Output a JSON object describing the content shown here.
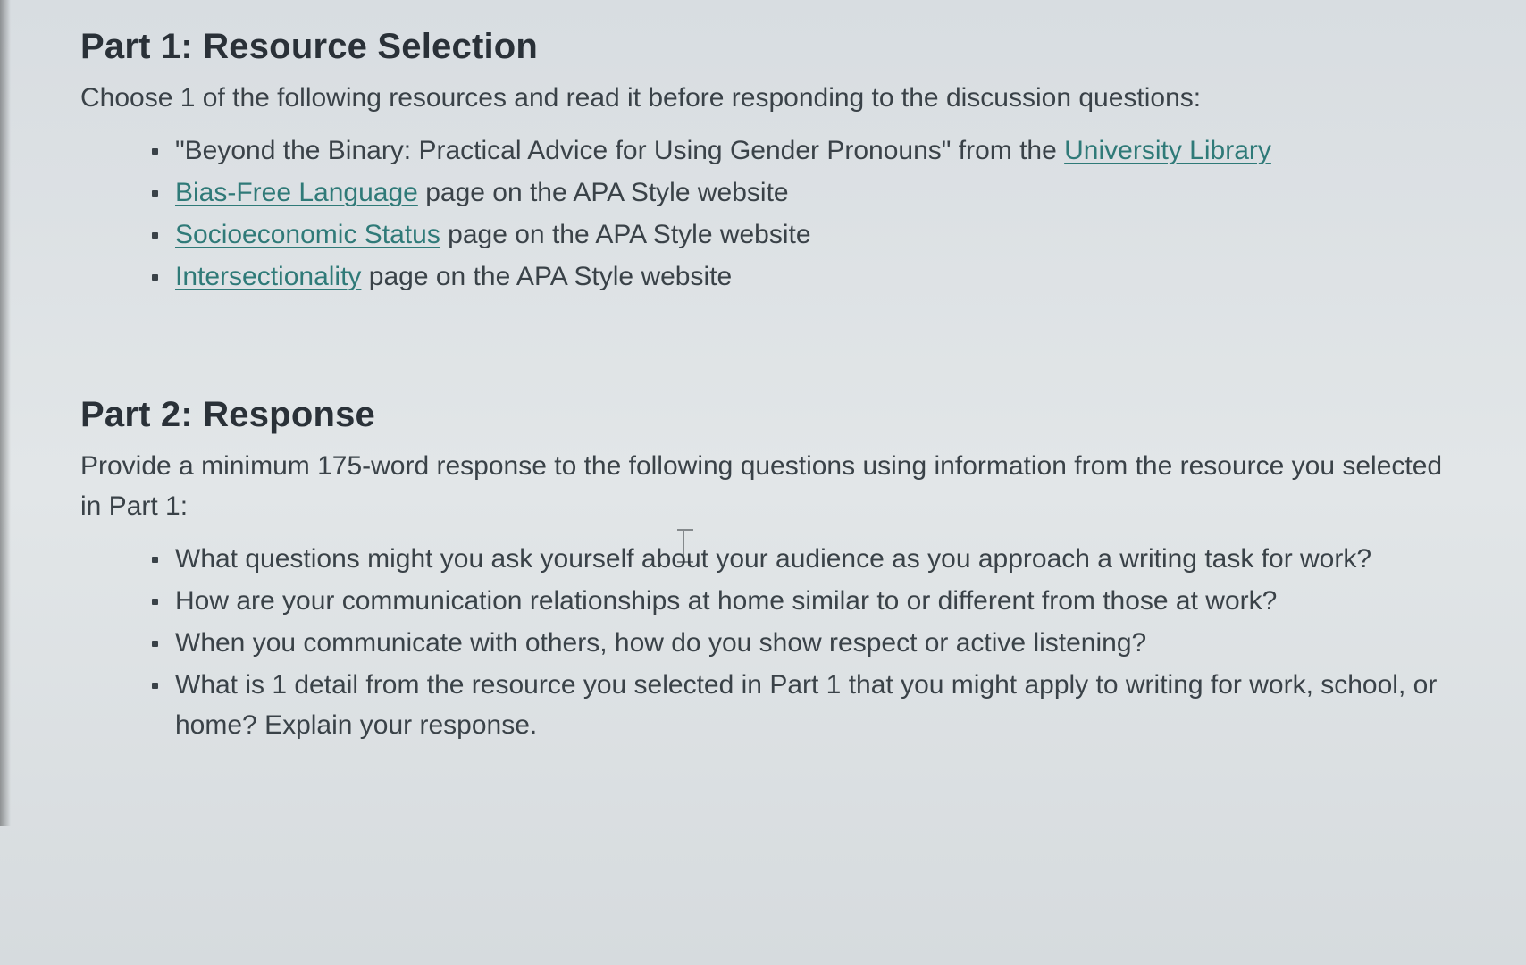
{
  "part1": {
    "heading": "Part 1: Resource Selection",
    "intro": "Choose 1 of the following resources and read it before responding to the discussion questions:",
    "items": [
      {
        "pre": "\"Beyond the Binary: Practical Advice for Using Gender Pronouns\" from the ",
        "link": "University Library",
        "post": ""
      },
      {
        "pre": "",
        "link": "Bias-Free Language",
        "post": " page on the APA Style website"
      },
      {
        "pre": "",
        "link": "Socioeconomic Status",
        "post": " page on the APA Style website"
      },
      {
        "pre": "",
        "link": "Intersectionality",
        "post": " page on the APA Style website"
      }
    ]
  },
  "part2": {
    "heading": "Part 2: Response",
    "intro": "Provide a minimum 175-word response to the following questions using information from the resource you selected in Part 1:",
    "items": [
      "What questions might you ask yourself about your audience as you approach a writing task for work?",
      "How are your communication relationships at home similar to or different from those at work?",
      "When you communicate with others, how do you show respect or active listening?",
      "What is 1 detail from the resource you selected in Part 1 that you might apply to writing for work, school, or home? Explain your response."
    ]
  }
}
